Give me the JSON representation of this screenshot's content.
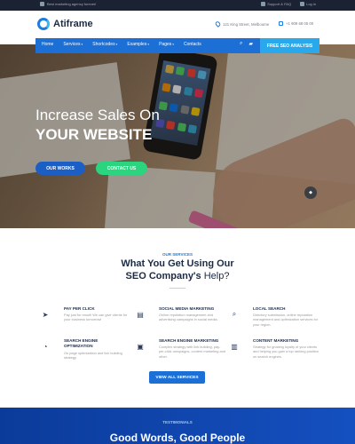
{
  "topbar": {
    "tagline": "Best marketing agency forever!",
    "support": "Support & FAQ",
    "login": "Log in"
  },
  "header": {
    "logo_text": "Atiframe",
    "address": "121 King Street, Melbourne",
    "phone": "+1 909 68 05 00"
  },
  "nav": {
    "items": [
      {
        "label": "Home"
      },
      {
        "label": "Services",
        "caret": "▾"
      },
      {
        "label": "Shortcodes",
        "caret": "▾"
      },
      {
        "label": "Examples",
        "caret": "▾"
      },
      {
        "label": "Pages",
        "caret": "▾"
      },
      {
        "label": "Contacts"
      }
    ],
    "cta": "FREE SEO ANALYSIS",
    "search_icon": "search-icon",
    "cart_icon": "cart-icon"
  },
  "hero": {
    "title_line1": "Increase Sales On",
    "title_line2": "YOUR WEBSITE",
    "btn_works": "OUR WORKS",
    "btn_contact": "CONTACT US",
    "scroll_icon": "chevron-icon"
  },
  "services": {
    "eyebrow": "OUR SERVICES",
    "title_line1": "What You Get Using Our",
    "title_line2_bold": "SEO Company's",
    "title_line2_rest": " Help?",
    "items": [
      {
        "icon": "megaphone-icon",
        "title": "PAY PER CLICK",
        "desc": "Pay just for result! We can give clients for your business tomorrow!"
      },
      {
        "icon": "chat-icon",
        "title": "SOCIAL MEDIA MARKETING",
        "desc": "Online reputation management and advertising campaigns in social media."
      },
      {
        "icon": "magnifier-icon",
        "title": "LOCAL SEARCH",
        "desc": "Directory submission, online reputation management and optimization services for your region."
      },
      {
        "icon": "chart-icon",
        "title": "SEARCH ENGINE OPTIMIZATION",
        "desc": "On page optimization and link building strategy."
      },
      {
        "icon": "monitor-icon",
        "title": "SEARCH ENGINE MARKETING",
        "desc": "Complex strategy with link building, pay-per-click campaigns, content marketing and other."
      },
      {
        "icon": "book-icon",
        "title": "CONTENT MARKETING",
        "desc": "Strategy for growing loyalty of your clients and helping you gain a top ranking position on search engines."
      }
    ],
    "view_all": "VIEW ALL SERVICES"
  },
  "testimonials": {
    "eyebrow": "TESTIMONIALS",
    "title": "Good Words, Good People"
  },
  "colors": {
    "primary": "#1c6fd4",
    "accent_green": "#2bd47e",
    "accent_sky": "#2aa8ec",
    "topbar": "#1a2233",
    "testimonials_bg": "#0b3b9a"
  }
}
